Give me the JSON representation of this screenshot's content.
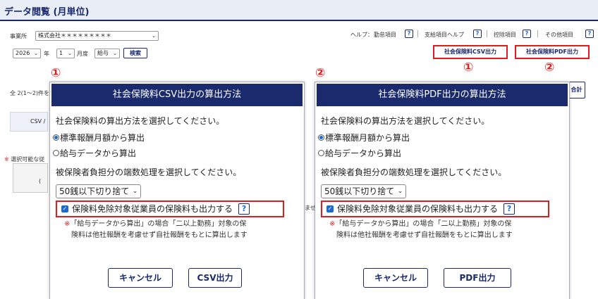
{
  "page": {
    "title": "データ閲覧 (月単位)"
  },
  "filters": {
    "office_label": "事業所",
    "office_value": "株式会社＊＊＊＊＊＊＊＊＊",
    "year_value": "2026",
    "year_suffix": "年",
    "month_value": "1",
    "month_suffix": "月度",
    "type_value": "給与",
    "search_label": "検索"
  },
  "help": {
    "label": "ヘルプ：",
    "items": [
      "勤怠項目",
      "支給項目ヘルプ",
      "控除項目",
      "その他項目"
    ],
    "q": "?"
  },
  "top_buttons": {
    "csv": "社会保険料CSV出力",
    "pdf": "社会保険料PDF出力"
  },
  "markers": {
    "one": "①",
    "two": "②"
  },
  "background": {
    "count_text": "全 2(1〜2)件を",
    "csv_tab": "CSV /",
    "notice_mark": "※",
    "notice_text": "選択可能な従",
    "right_btn": "合計",
    "frag_left": "(",
    "frag_mid": "ませ"
  },
  "modal_csv": {
    "title": "社会保険料CSV出力の算出方法",
    "prompt": "社会保険料の算出方法を選択してください。",
    "opt1": "標準報酬月額から算出",
    "opt2": "給与データから算出",
    "rounding_prompt": "被保険者負担分の端数処理を選択してください。",
    "rounding_value": "50銭以下切り捨て",
    "checkbox_label": "保険料免除対象従業員の保険料も出力する",
    "q": "?",
    "note_mark": "※",
    "note_line1": "「給与データから算出」の場合「二以上勤務」対象の保",
    "note_line2": "険料は他社報酬を考慮せず自社報酬をもとに算出します",
    "cancel": "キャンセル",
    "submit": "CSV出力"
  },
  "modal_pdf": {
    "title": "社会保険料PDF出力の算出方法",
    "prompt": "社会保険料の算出方法を選択してください。",
    "opt1": "標準報酬月額から算出",
    "opt2": "給与データから算出",
    "rounding_prompt": "被保険者負担分の端数処理を選択してください。",
    "rounding_value": "50銭以下切り捨て",
    "checkbox_label": "保険料免除対象従業員の保険料も出力する",
    "q": "?",
    "note_mark": "※",
    "note_line1": "「給与データから算出」の場合「二以上勤務」対象の保",
    "note_line2": "険料は他社報酬を考慮せず自社報酬をもとに算出します",
    "cancel": "キャンセル",
    "submit": "PDF出力"
  },
  "colors": {
    "accent": "#1a2a6c",
    "highlight": "#e01c1c",
    "link": "#1a6ad0"
  }
}
